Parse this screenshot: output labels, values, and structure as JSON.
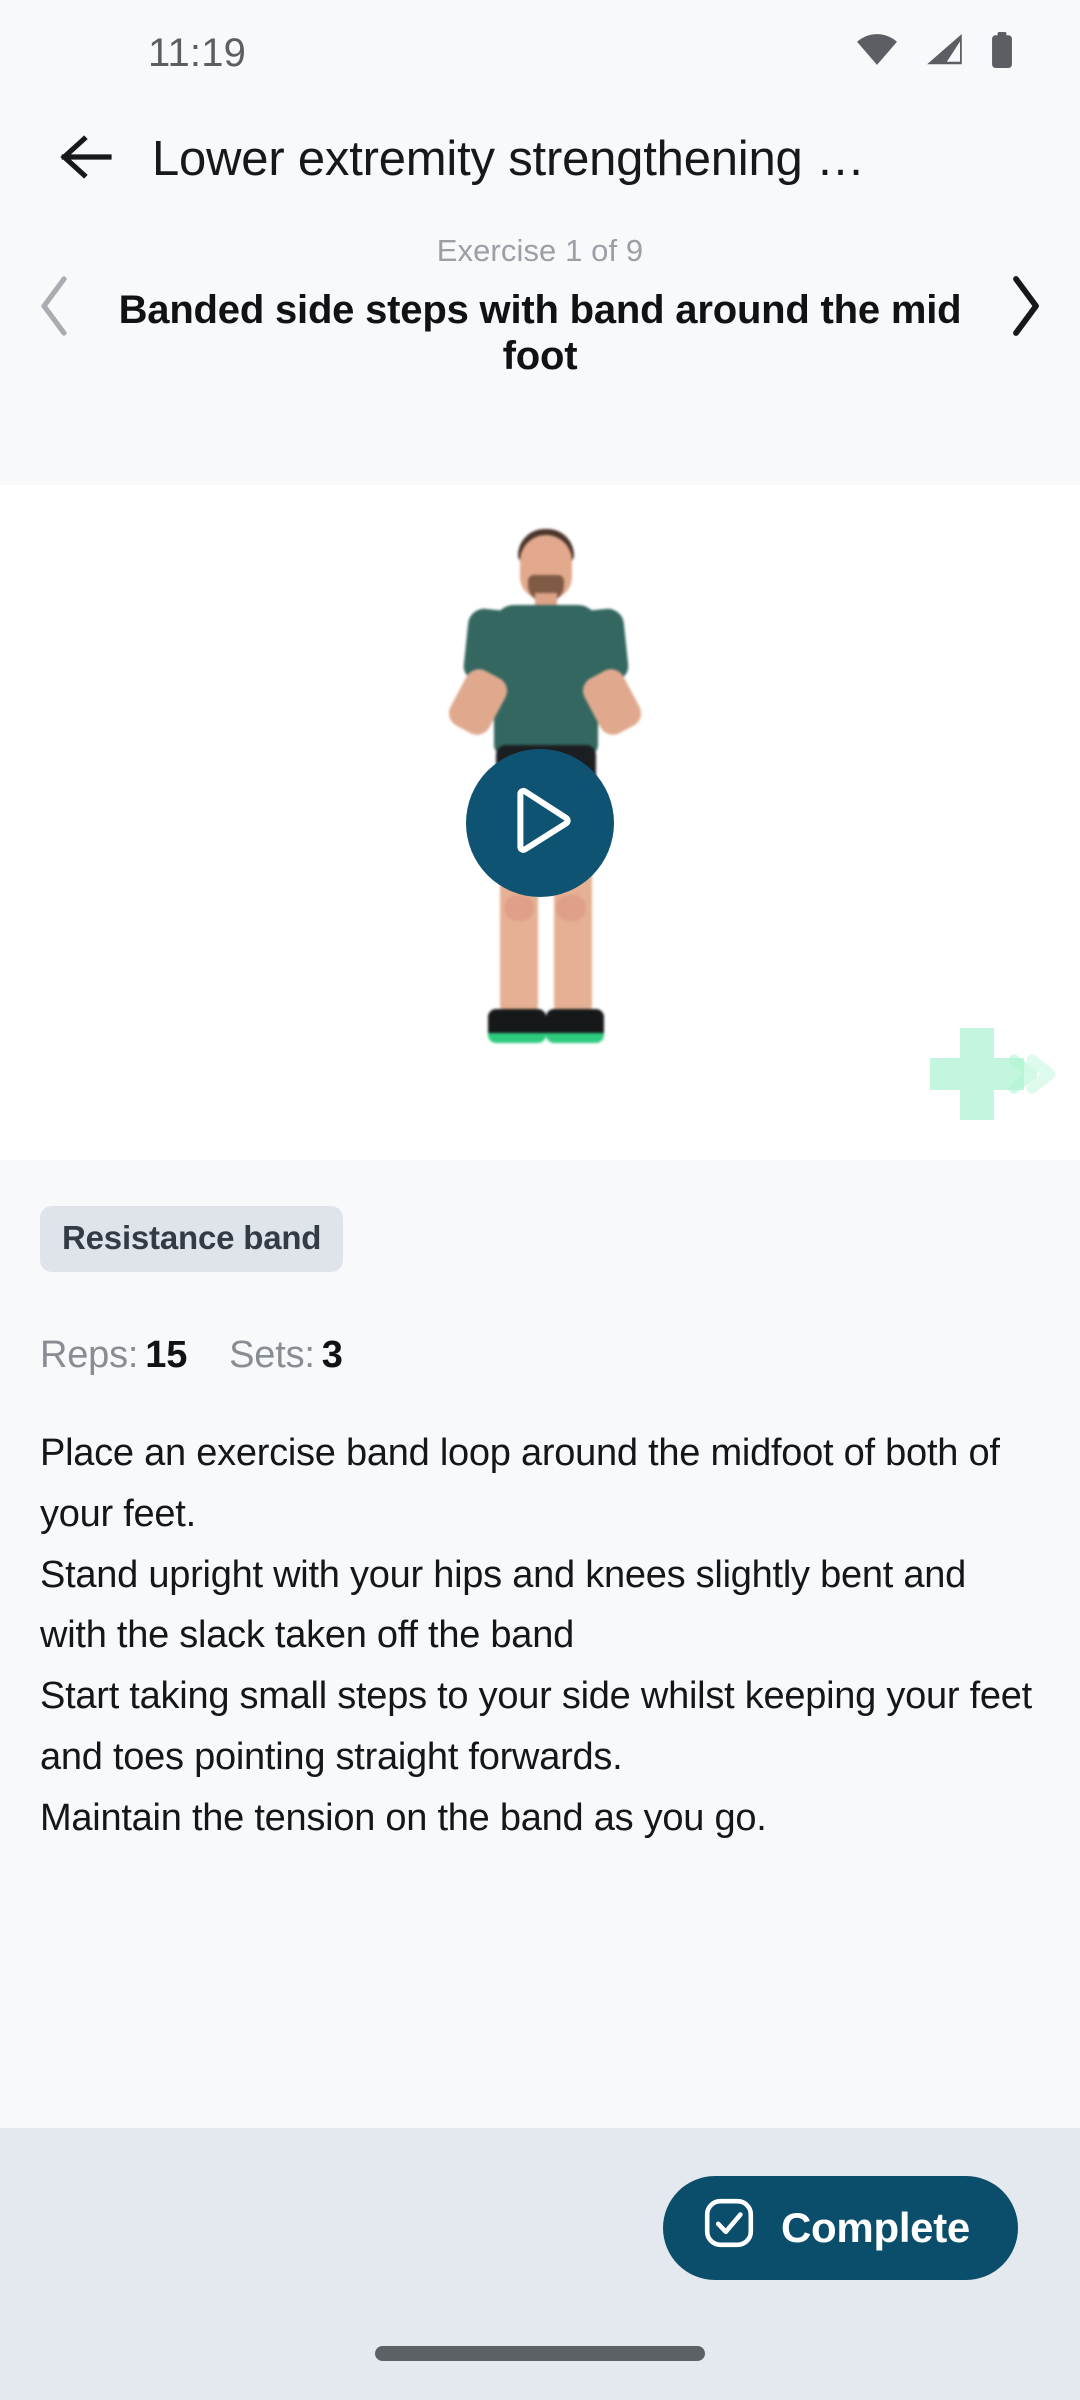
{
  "status_bar": {
    "time": "11:19",
    "icons": [
      "wifi-icon",
      "cellular-signal-icon",
      "battery-icon"
    ]
  },
  "app_bar": {
    "back_icon": "arrow-left-icon",
    "title": "Lower extremity strengthening …"
  },
  "exercise_nav": {
    "prev_icon": "chevron-left-icon",
    "next_icon": "chevron-right-icon",
    "counter": "Exercise 1 of 9",
    "current_index": 1,
    "total": 9,
    "title": "Banded side steps with band around the mid foot"
  },
  "video": {
    "play_icon": "play-icon",
    "watermark_icon": "medical-cross-chevrons-logo-icon",
    "background": "#ffffff"
  },
  "details": {
    "equipment_chip": "Resistance band",
    "reps_label": "Reps:",
    "reps_value": "15",
    "sets_label": "Sets:",
    "sets_value": "3",
    "description": "Place an exercise band loop around the midfoot of both of your feet.\nStand upright with your hips and knees slightly bent and with the slack taken off the band\nStart taking small steps to your side whilst keeping your feet and toes pointing straight forwards.\nMaintain the tension on the band as you go."
  },
  "action_bar": {
    "complete_label": "Complete",
    "complete_icon": "checkbox-check-icon"
  },
  "colors": {
    "page_background": "#f7f9fb",
    "video_background": "#ffffff",
    "accent_teal": "#0a4e6b",
    "play_button": "#0f5373",
    "chip_background": "#dfe4eb",
    "action_bar_background": "#e4e9f0",
    "muted_text": "#9aa0a6",
    "body_text": "#14171a",
    "watermark_green": "#b7f5d8"
  }
}
